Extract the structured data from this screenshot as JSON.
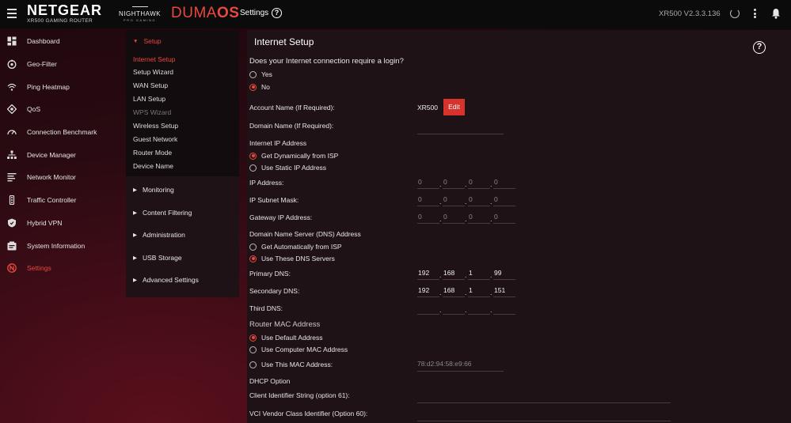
{
  "header": {
    "brand": "NETGEAR",
    "brand_sub": "XR500 GAMING ROUTER",
    "nighthawk": "NIGHTHAWK",
    "nighthawk_sub": "PRO GAMING",
    "duma_a": "DUMA",
    "duma_b": "OS",
    "section": "Settings",
    "help_glyph": "?",
    "version": "XR500 V2.3.3.136"
  },
  "colors": {
    "accent": "#e8493f",
    "edit_button": "#d7332d",
    "topbar": "#0b0b0b",
    "panel": "#1e1216"
  },
  "leftnav": [
    {
      "label": "Dashboard",
      "icon": "dashboard-icon"
    },
    {
      "label": "Geo-Filter",
      "icon": "geo-filter-icon"
    },
    {
      "label": "Ping Heatmap",
      "icon": "wifi-icon"
    },
    {
      "label": "QoS",
      "icon": "qos-icon"
    },
    {
      "label": "Connection Benchmark",
      "icon": "speedometer-icon"
    },
    {
      "label": "Device Manager",
      "icon": "network-tree-icon"
    },
    {
      "label": "Network Monitor",
      "icon": "list-icon"
    },
    {
      "label": "Traffic Controller",
      "icon": "traffic-icon"
    },
    {
      "label": "Hybrid VPN",
      "icon": "shield-icon"
    },
    {
      "label": "System Information",
      "icon": "system-info-icon"
    },
    {
      "label": "Settings",
      "icon": "settings-icon",
      "active": true
    }
  ],
  "subnav": {
    "open_section": "Setup",
    "open_items": [
      "Internet Setup",
      "Setup Wizard",
      "WAN Setup",
      "LAN Setup",
      "WPS Wizard",
      "Wireless Setup",
      "Guest Network",
      "Router Mode",
      "Device Name"
    ],
    "active_item": "Internet Setup",
    "disabled_item": "WPS Wizard",
    "collapsed_sections": [
      "Monitoring",
      "Content Filtering",
      "Administration",
      "USB Storage",
      "Advanced Settings"
    ]
  },
  "main": {
    "title": "Internet Setup",
    "help_glyph": "?",
    "login_question": "Does your Internet connection require a login?",
    "login_yes": "Yes",
    "login_no": "No",
    "account_name_label": "Account Name  (If Required):",
    "account_name_value": "XR500",
    "edit_label": "Edit",
    "domain_name_label": "Domain Name  (If Required):",
    "internet_ip_heading": "Internet IP Address",
    "ip_dynamic": "Get Dynamically from ISP",
    "ip_static": "Use Static IP Address",
    "ip_address_label": "IP Address:",
    "subnet_label": "IP Subnet Mask:",
    "gateway_label": "Gateway IP Address:",
    "ip_address": [
      "0",
      "0",
      "0",
      "0"
    ],
    "subnet": [
      "0",
      "0",
      "0",
      "0"
    ],
    "gateway": [
      "0",
      "0",
      "0",
      "0"
    ],
    "dns_heading": "Domain Name Server (DNS) Address",
    "dns_auto": "Get Automatically from ISP",
    "dns_manual": "Use These DNS Servers",
    "primary_dns_label": "Primary DNS:",
    "secondary_dns_label": "Secondary DNS:",
    "third_dns_label": "Third DNS:",
    "primary_dns": [
      "192",
      "168",
      "1",
      "99"
    ],
    "secondary_dns": [
      "192",
      "168",
      "1",
      "151"
    ],
    "third_dns": [
      "",
      "",
      "",
      ""
    ],
    "mac_heading": "Router MAC Address",
    "mac_default": "Use Default Address",
    "mac_computer": "Use Computer MAC Address",
    "mac_this": "Use This MAC Address:",
    "mac_value": "78:d2:94:58:e9:66",
    "dhcp_heading": "DHCP Option",
    "client_id_label": "Client Identifier String (option 61):",
    "vci_label": "VCI Vendor Class Identifier (Option 60):",
    "ip_separator": "."
  }
}
